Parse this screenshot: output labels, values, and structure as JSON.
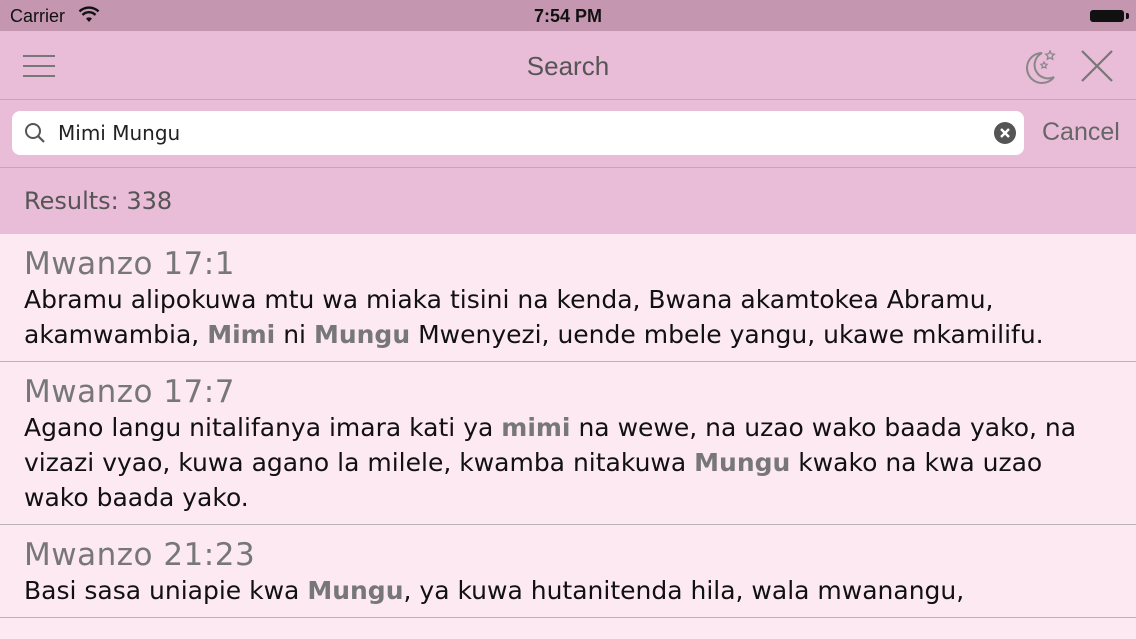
{
  "status_bar": {
    "carrier": "Carrier",
    "time": "7:54 PM"
  },
  "nav": {
    "title": "Search",
    "icons": [
      "menu-icon",
      "night-mode-icon",
      "close-icon"
    ]
  },
  "search": {
    "value": "Mimi Mungu",
    "cancel_label": "Cancel"
  },
  "results": {
    "label": "Results: 338",
    "items": [
      {
        "ref": "Mwanzo 17:1",
        "parts": [
          {
            "t": "Abramu alipokuwa mtu wa miaka tisini na kenda, Bwana akamtokea Abramu, akamwambia, ",
            "h": false
          },
          {
            "t": "Mimi",
            "h": true
          },
          {
            "t": " ni ",
            "h": false
          },
          {
            "t": "Mungu",
            "h": true
          },
          {
            "t": " Mwenyezi, uende mbele yangu, ukawe mkamilifu.",
            "h": false
          }
        ]
      },
      {
        "ref": "Mwanzo 17:7",
        "parts": [
          {
            "t": "Agano langu nitalifanya imara kati ya ",
            "h": false
          },
          {
            "t": "mimi",
            "h": true
          },
          {
            "t": " na wewe, na uzao wako baada yako, na vizazi vyao, kuwa agano la milele, kwamba nitakuwa ",
            "h": false
          },
          {
            "t": "Mungu",
            "h": true
          },
          {
            "t": " kwako na kwa uzao wako baada yako.",
            "h": false
          }
        ]
      },
      {
        "ref": "Mwanzo 21:23",
        "parts": [
          {
            "t": "Basi sasa uniapie kwa ",
            "h": false
          },
          {
            "t": "Mungu",
            "h": true
          },
          {
            "t": ", ya kuwa hutanitenda hila, wala mwanangu,",
            "h": false
          }
        ]
      }
    ]
  },
  "colors": {
    "status_bar": "#c596b0",
    "nav_bar": "#e9bcd8",
    "list_background": "#fde9f2",
    "highlight_text": "#777777"
  }
}
